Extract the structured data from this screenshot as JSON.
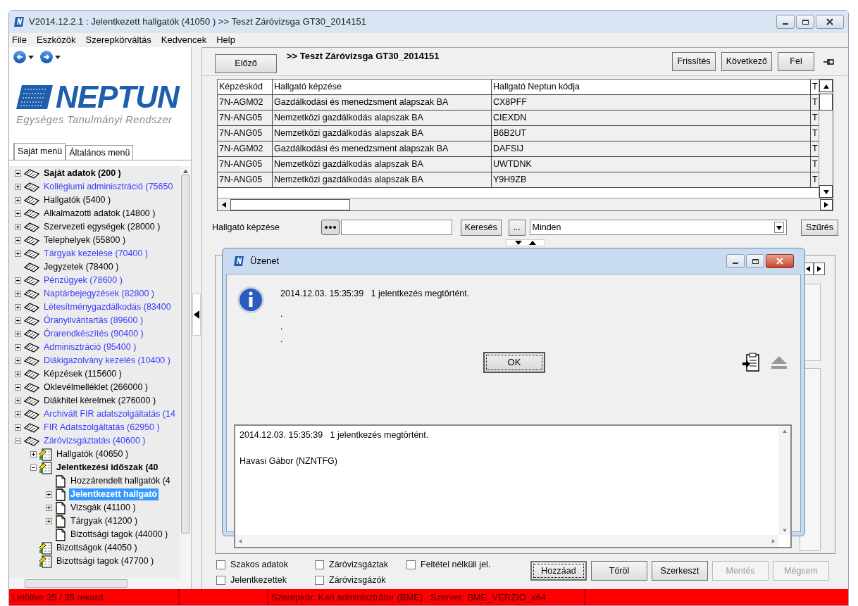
{
  "window": {
    "title": "V2014.12.2.1 : Jelentkezett hallgatók (41050  )  >> Teszt Záróvizsga GT30_2014151"
  },
  "menu": [
    "File",
    "Eszközök",
    "Szerepkörváltás",
    "Kedvencek",
    "Help"
  ],
  "logo": {
    "name": "NEPTUN",
    "subtitle": "Egységes Tanulmányi Rendszer"
  },
  "sidebar_tabs": [
    {
      "label": "Saját menü",
      "selected": true
    },
    {
      "label": "Általános menü",
      "selected": false
    }
  ],
  "tree": [
    {
      "label": "Saját adatok (200  )",
      "kind": "book",
      "color": "#000000",
      "bold": true,
      "expanded": false,
      "selected": false
    },
    {
      "label": "Kollégiumi adminisztráció (75650",
      "kind": "book",
      "color": "#3a3aff",
      "bold": false,
      "expanded": false,
      "selected": false
    },
    {
      "label": "Hallgatók (5400  )",
      "kind": "book",
      "color": "#000000",
      "bold": false,
      "expanded": false,
      "selected": false
    },
    {
      "label": "Alkalmazotti adatok (14800  )",
      "kind": "book",
      "color": "#000000",
      "bold": false,
      "expanded": false,
      "selected": false
    },
    {
      "label": "Szervezeti egységek (28000  )",
      "kind": "book",
      "color": "#000000",
      "bold": false,
      "expanded": false,
      "selected": false
    },
    {
      "label": "Telephelyek (55800  )",
      "kind": "book",
      "color": "#000000",
      "bold": false,
      "expanded": false,
      "selected": false
    },
    {
      "label": "Tárgyak kezelése (70400  )",
      "kind": "book",
      "color": "#3a3aff",
      "bold": false,
      "expanded": false,
      "selected": false
    },
    {
      "label": "Jegyzetek (78400  )",
      "kind": "book",
      "color": "#000000",
      "bold": false,
      "selected": false
    },
    {
      "label": "Pénzügyek (78600  )",
      "kind": "book",
      "color": "#3a3aff",
      "bold": false,
      "expanded": false,
      "selected": false
    },
    {
      "label": "Naptárbejegyzések (82800  )",
      "kind": "book",
      "color": "#3a3aff",
      "bold": false,
      "expanded": false,
      "selected": false
    },
    {
      "label": "Létesítménygazdálkodás (83400",
      "kind": "book",
      "color": "#3a3aff",
      "bold": false,
      "expanded": false,
      "selected": false
    },
    {
      "label": "Óranyilvántartás (89600  )",
      "kind": "book",
      "color": "#3a3aff",
      "bold": false,
      "expanded": false,
      "selected": false
    },
    {
      "label": "Órarendkészítés (90400  )",
      "kind": "book",
      "color": "#3a3aff",
      "bold": false,
      "expanded": false,
      "selected": false
    },
    {
      "label": "Adminisztráció (95400  )",
      "kind": "book",
      "color": "#3a3aff",
      "bold": false,
      "expanded": false,
      "selected": false
    },
    {
      "label": "Diákigazolvány kezelés (10400  )",
      "kind": "book",
      "color": "#3a3aff",
      "bold": false,
      "expanded": false,
      "selected": false
    },
    {
      "label": "Képzések (115600  )",
      "kind": "book",
      "color": "#000000",
      "bold": false,
      "expanded": false,
      "selected": false
    },
    {
      "label": "Oklevélmelléklet (266000  )",
      "kind": "book",
      "color": "#000000",
      "bold": false,
      "expanded": false,
      "selected": false
    },
    {
      "label": "Diákhitel kérelmek (276000  )",
      "kind": "book",
      "color": "#000000",
      "bold": false,
      "expanded": false,
      "selected": false
    },
    {
      "label": "Archivált FIR adatszolgáltatás (14",
      "kind": "book",
      "color": "#3a3aff",
      "bold": false,
      "expanded": false,
      "selected": false
    },
    {
      "label": "FIR Adatszolgáltatás (62950  )",
      "kind": "book",
      "color": "#3a3aff",
      "bold": false,
      "expanded": false,
      "selected": false
    },
    {
      "label": "Záróvizsgáztatás (40600  )",
      "kind": "book",
      "color": "#3a3aff",
      "bold": false,
      "expanded": true,
      "selected": false,
      "children": [
        {
          "label": "Hallgatók (40650  )",
          "kind": "form",
          "color": "#000000",
          "bold": false,
          "expanded": false,
          "selected": false
        },
        {
          "label": "Jelentkezési időszak (40",
          "kind": "form",
          "color": "#000000",
          "bold": true,
          "expanded": true,
          "selected": false,
          "children": [
            {
              "label": "Hozzárendelt hallgatók (4",
              "kind": "page",
              "color": "#000000",
              "bold": false,
              "selected": false
            },
            {
              "label": "Jelentkezett hallgató",
              "kind": "page",
              "bold": true,
              "expanded": false,
              "selected": true
            },
            {
              "label": "Vizsgák (41100  )",
              "kind": "page",
              "color": "#000000",
              "bold": false,
              "expanded": false,
              "selected": false
            },
            {
              "label": "Tárgyak (41200  )",
              "kind": "page",
              "color": "#000000",
              "bold": false,
              "expanded": false,
              "selected": false
            },
            {
              "label": "Bizottsági tagok (44000  )",
              "kind": "page",
              "color": "#000000",
              "bold": false,
              "selected": false
            }
          ]
        },
        {
          "label": "Bizottságok (44050  )",
          "kind": "form",
          "color": "#000000",
          "bold": false,
          "selected": false
        },
        {
          "label": "Bizottsági tagok (47700  )",
          "kind": "form",
          "color": "#000000",
          "bold": false,
          "selected": false
        }
      ]
    }
  ],
  "toolbar": {
    "prev": "Előző",
    "title": ">> Teszt Záróvizsga GT30_2014151",
    "buttons": [
      "Frissítés",
      "Következő",
      "Fel"
    ]
  },
  "table": {
    "columns": [
      "Képzéskód",
      "Hallgató képzése",
      "Hallgató Neptun kódja",
      "T"
    ],
    "rows": [
      [
        "7N-AGM02",
        "Gazdálkodási és menedzsment alapszak BA",
        "CX8PFF",
        "T"
      ],
      [
        "7N-ANG05",
        "Nemzetközi gazdálkodás alapszak BA",
        "CIEXDN",
        "T"
      ],
      [
        "7N-ANG05",
        "Nemzetközi gazdálkodás alapszak BA",
        "B6B2UT",
        "T"
      ],
      [
        "7N-AGM02",
        "Gazdálkodási és menedzsment alapszak BA",
        "DAFSIJ",
        "T"
      ],
      [
        "7N-ANG05",
        "Nemzetközi gazdálkodás alapszak BA",
        "UWTDNK",
        "T"
      ],
      [
        "7N-ANG05",
        "Nemzetközi gazdálkodás alapszak BA",
        "Y9H9ZB",
        "T"
      ]
    ]
  },
  "filter": {
    "label": "Hallgató képzése",
    "search": "Keresés",
    "more": "...",
    "dropdown": "Minden",
    "apply": "Szűrés"
  },
  "checkboxes": [
    {
      "label": "Szakos adatok",
      "checked": false
    },
    {
      "label": "Jelentkezettek",
      "checked": false
    },
    {
      "label": "Záróvizsgáztak",
      "checked": false
    },
    {
      "label": "Záróvizsgázók",
      "checked": false
    },
    {
      "label": "Feltétel nélküli jel.",
      "checked": false
    }
  ],
  "actions": [
    {
      "label": "Hozzáad",
      "disabled": false,
      "default": true
    },
    {
      "label": "Töröl",
      "disabled": false,
      "default": false
    },
    {
      "label": "Szerkeszt",
      "disabled": false,
      "default": false
    },
    {
      "label": "Mentés",
      "disabled": true,
      "default": false
    },
    {
      "label": "Mégsem",
      "disabled": true,
      "default": false
    }
  ],
  "status_bar": [
    "Letöltve 35 / 35 rekord.",
    "Szerepkör: Kari adminisztrátor (BME)   Szerver: BME_VERZIO_x64"
  ],
  "dialog": {
    "title": "Üzenet",
    "message": "2014.12.03. 15:35:39   1 jelentkezés megtörtént.",
    "dots": [
      ".",
      ".",
      "."
    ],
    "ok": "OK",
    "log": [
      "2014.12.03. 15:35:39   1 jelentkezés megtörtént.",
      "Havasi Gábor (NZNTFG)"
    ]
  }
}
